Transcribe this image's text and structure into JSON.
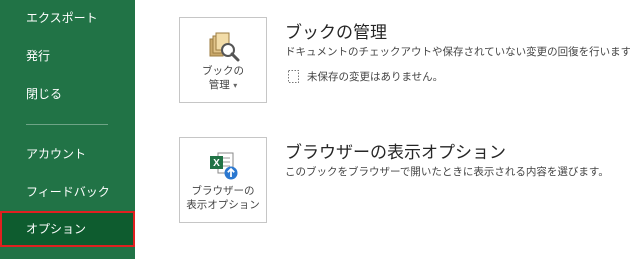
{
  "sidebar": {
    "items": [
      {
        "label": "エクスポート"
      },
      {
        "label": "発行"
      },
      {
        "label": "閉じる"
      },
      {
        "label": "アカウント"
      },
      {
        "label": "フィードバック"
      },
      {
        "label": "オプション",
        "selected": true
      }
    ]
  },
  "manage": {
    "button_line1": "ブックの",
    "button_line2": "管理",
    "title": "ブックの管理",
    "description": "ドキュメントのチェックアウトや保存されていない変更の回復を行います。",
    "info": "未保存の変更はありません。"
  },
  "browser": {
    "button_line1": "ブラウザーの",
    "button_line2": "表示オプション",
    "title": "ブラウザーの表示オプション",
    "description": "このブックをブラウザーで開いたときに表示される内容を選びます。"
  },
  "colors": {
    "sidebar_bg": "#217346",
    "selected_bg": "#0e5c2f",
    "highlight_border": "#e02020"
  }
}
